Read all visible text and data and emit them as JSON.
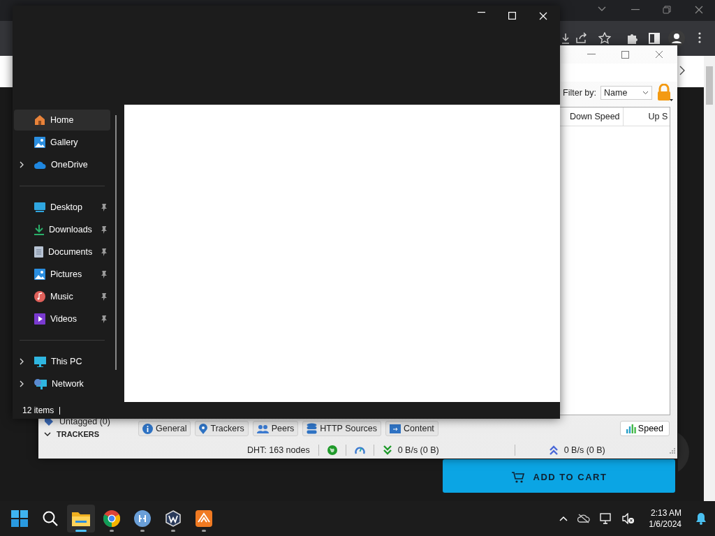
{
  "browser": {
    "cart_button": "ADD TO CART"
  },
  "qbittorrent": {
    "filter_label": "Filter by:",
    "filter_value": "Name",
    "columns": [
      "Down Speed",
      "Up S"
    ],
    "side_items": [
      {
        "label": "Untagged (0)",
        "kind": "tag"
      },
      {
        "label": "TRACKERS",
        "kind": "header"
      }
    ],
    "tabs": [
      {
        "label": "General",
        "kind": "info"
      },
      {
        "label": "Trackers",
        "kind": "pin"
      },
      {
        "label": "Peers",
        "kind": "people"
      },
      {
        "label": "HTTP Sources",
        "kind": "database"
      },
      {
        "label": "Content",
        "kind": "folder"
      }
    ],
    "speed_button": "Speed",
    "status": {
      "dht": "DHT: 163 nodes",
      "down": "0 B/s (0 B)",
      "up": "0 B/s (0 B)"
    }
  },
  "explorer": {
    "nav_groups": [
      [
        {
          "label": "Home",
          "kind": "home",
          "expandable": false,
          "pinned": false,
          "selected": true
        },
        {
          "label": "Gallery",
          "kind": "gallery",
          "expandable": false,
          "pinned": false,
          "selected": false
        },
        {
          "label": "OneDrive",
          "kind": "cloud",
          "expandable": true,
          "pinned": false,
          "selected": false
        }
      ],
      [
        {
          "label": "Desktop",
          "kind": "desktop",
          "expandable": false,
          "pinned": true,
          "selected": false
        },
        {
          "label": "Downloads",
          "kind": "download",
          "expandable": false,
          "pinned": true,
          "selected": false
        },
        {
          "label": "Documents",
          "kind": "document",
          "expandable": false,
          "pinned": true,
          "selected": false
        },
        {
          "label": "Pictures",
          "kind": "gallery",
          "expandable": false,
          "pinned": true,
          "selected": false
        },
        {
          "label": "Music",
          "kind": "music",
          "expandable": false,
          "pinned": true,
          "selected": false
        },
        {
          "label": "Videos",
          "kind": "video",
          "expandable": false,
          "pinned": true,
          "selected": false
        }
      ],
      [
        {
          "label": "This PC",
          "kind": "pc",
          "expandable": true,
          "pinned": false,
          "selected": false
        },
        {
          "label": "Network",
          "kind": "network",
          "expandable": true,
          "pinned": false,
          "selected": false
        }
      ]
    ],
    "status": "12 items"
  },
  "taskbar": {
    "apps": [
      {
        "kind": "start",
        "active": false,
        "running": false
      },
      {
        "kind": "search",
        "active": false,
        "running": false
      },
      {
        "kind": "folder",
        "active": true,
        "running": true
      },
      {
        "kind": "chrome",
        "active": false,
        "running": true
      },
      {
        "kind": "qb",
        "active": false,
        "running": true
      },
      {
        "kind": "w",
        "active": false,
        "running": true
      },
      {
        "kind": "triangle",
        "active": false,
        "running": true
      }
    ],
    "time": "2:13 AM",
    "date": "1/6/2024"
  }
}
